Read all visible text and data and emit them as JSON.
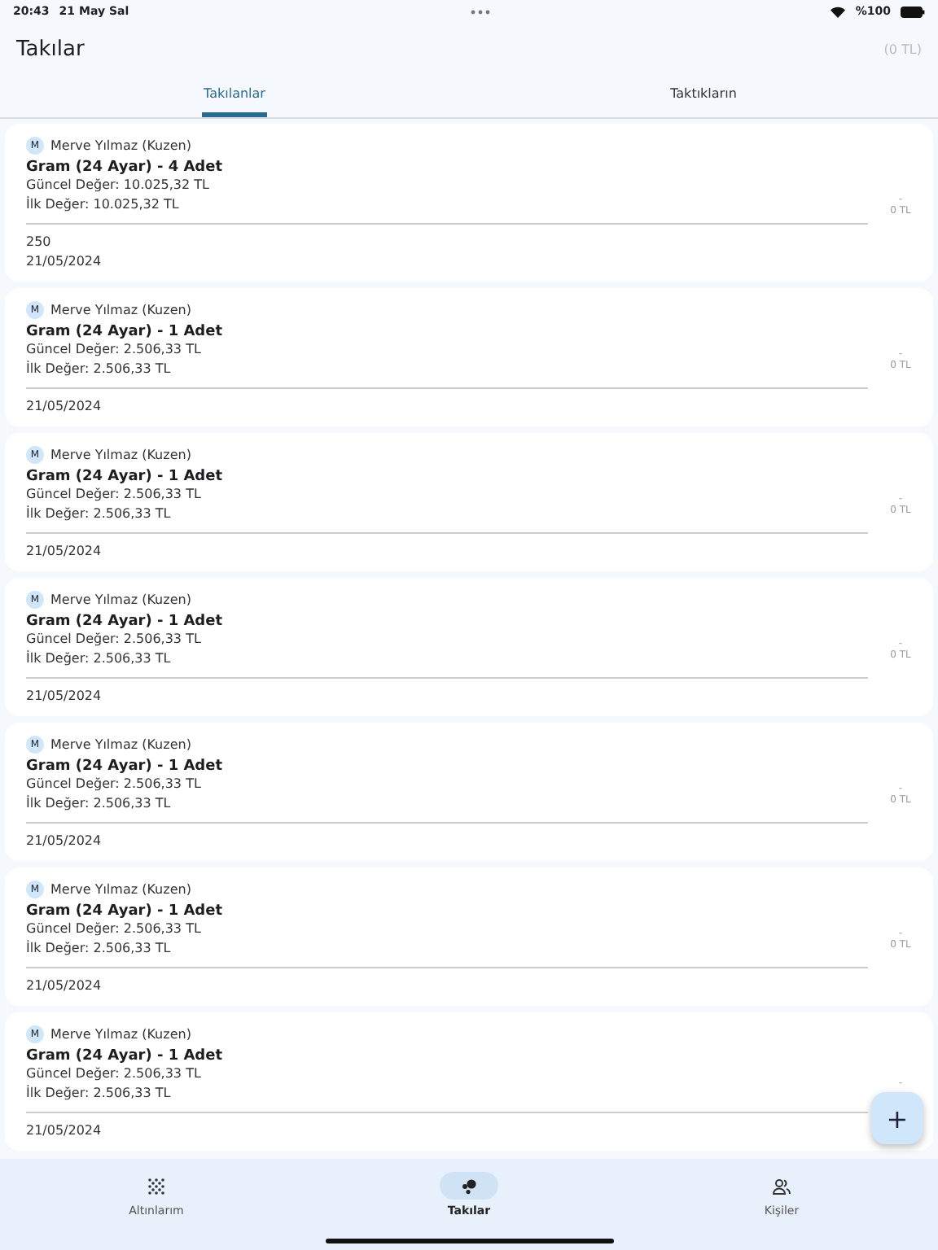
{
  "status_bar": {
    "time": "20:43",
    "date": "21 May Sal",
    "battery": "%100"
  },
  "header": {
    "title": "Takılar",
    "total": "(0 TL)"
  },
  "tabs": [
    {
      "label": "Takılanlar",
      "selected": true
    },
    {
      "label": "Taktıkların",
      "selected": false
    }
  ],
  "cards": [
    {
      "initial": "M",
      "person": "Merve Yılmaz (Kuzen)",
      "title": "Gram (24 Ayar) - 4 Adet",
      "current": "Güncel Değer: 10.025,32 TL",
      "initial_value": "İlk Değer: 10.025,32 TL",
      "note": "250",
      "date": "21/05/2024",
      "side_dash": "-",
      "side_amount": "0 TL"
    },
    {
      "initial": "M",
      "person": "Merve Yılmaz (Kuzen)",
      "title": "Gram (24 Ayar) - 1 Adet",
      "current": "Güncel Değer: 2.506,33 TL",
      "initial_value": "İlk Değer: 2.506,33 TL",
      "date": "21/05/2024",
      "side_dash": "-",
      "side_amount": "0 TL"
    },
    {
      "initial": "M",
      "person": "Merve Yılmaz (Kuzen)",
      "title": "Gram (24 Ayar) - 1 Adet",
      "current": "Güncel Değer: 2.506,33 TL",
      "initial_value": "İlk Değer: 2.506,33 TL",
      "date": "21/05/2024",
      "side_dash": "-",
      "side_amount": "0 TL"
    },
    {
      "initial": "M",
      "person": "Merve Yılmaz (Kuzen)",
      "title": "Gram (24 Ayar) - 1 Adet",
      "current": "Güncel Değer: 2.506,33 TL",
      "initial_value": "İlk Değer: 2.506,33 TL",
      "date": "21/05/2024",
      "side_dash": "-",
      "side_amount": "0 TL"
    },
    {
      "initial": "M",
      "person": "Merve Yılmaz (Kuzen)",
      "title": "Gram (24 Ayar) - 1 Adet",
      "current": "Güncel Değer: 2.506,33 TL",
      "initial_value": "İlk Değer: 2.506,33 TL",
      "date": "21/05/2024",
      "side_dash": "-",
      "side_amount": "0 TL"
    },
    {
      "initial": "M",
      "person": "Merve Yılmaz (Kuzen)",
      "title": "Gram (24 Ayar) - 1 Adet",
      "current": "Güncel Değer: 2.506,33 TL",
      "initial_value": "İlk Değer: 2.506,33 TL",
      "date": "21/05/2024",
      "side_dash": "-",
      "side_amount": "0 TL"
    },
    {
      "initial": "M",
      "person": "Merve Yılmaz (Kuzen)",
      "title": "Gram (24 Ayar) - 1 Adet",
      "current": "Güncel Değer: 2.506,33 TL",
      "initial_value": "İlk Değer: 2.506,33 TL",
      "date": "21/05/2024",
      "side_dash": "-"
    }
  ],
  "fab": {
    "label": "+"
  },
  "nav": [
    {
      "label": "Altınlarım",
      "kind": "grid",
      "selected": false
    },
    {
      "label": "Takılar",
      "kind": "dots",
      "selected": true
    },
    {
      "label": "Kişiler",
      "kind": "people",
      "selected": false
    }
  ]
}
